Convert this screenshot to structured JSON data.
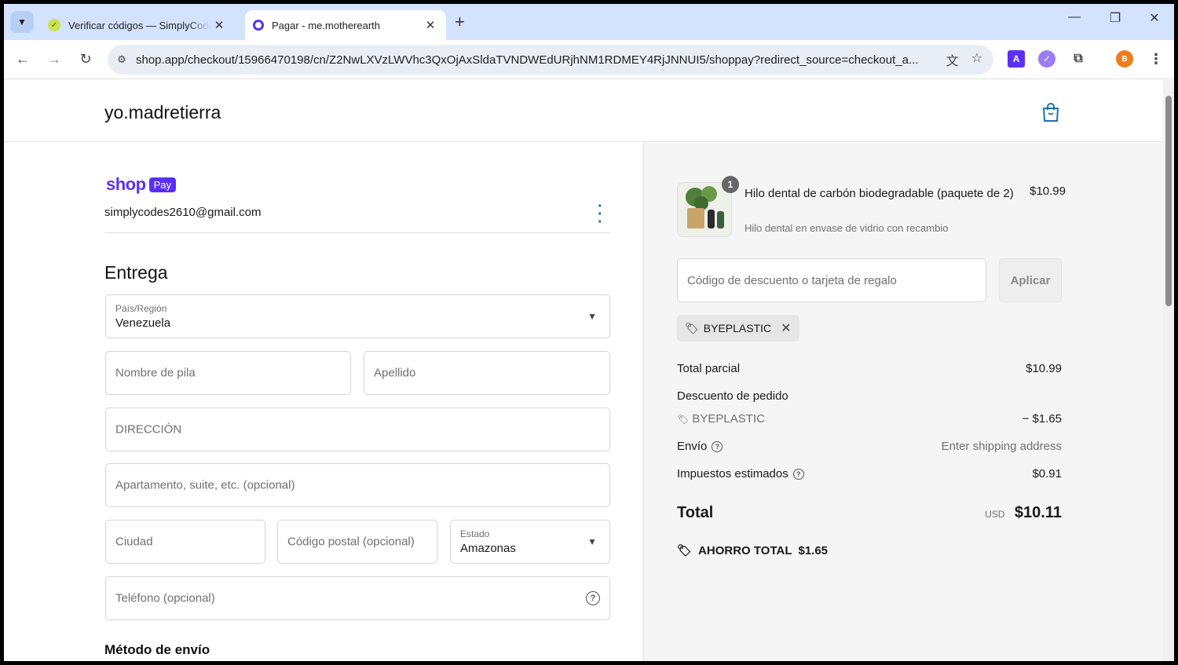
{
  "browser": {
    "tabs": [
      {
        "title": "Verificar códigos — SimplyCodes",
        "active": false
      },
      {
        "title": "Pagar - me.motherearth",
        "active": true
      }
    ],
    "url": "shop.app/checkout/15966470198/cn/Z2NwLXVzLWVhc3QxOjAxSldaTVNDWEdURjhNM1RDMEY4RjJNNUI5/shoppay?redirect_source=checkout_a...",
    "profile_initial": "B",
    "ext_letter": "A"
  },
  "header": {
    "shop_name": "yo.madretierra"
  },
  "account": {
    "shop_label": "shop",
    "pay_label": "Pay",
    "email": "simplycodes2610@gmail.com"
  },
  "delivery": {
    "heading": "Entrega",
    "country_label": "País/Región",
    "country_value": "Venezuela",
    "first_name_ph": "Nombre de pila",
    "last_name_ph": "Apellido",
    "address_ph": "DIRECCIÓN",
    "apartment_ph": "Apartamento, suite, etc. (opcional)",
    "city_ph": "Ciudad",
    "postal_ph": "Código postal (opcional)",
    "state_label": "Estado",
    "state_value": "Amazonas",
    "phone_ph": "Teléfono (opcional)"
  },
  "shipping_method_heading": "Método de envío",
  "summary": {
    "product": {
      "name": "Hilo dental de carbón biodegradable (paquete de 2)",
      "variant": "Hilo dental en envase de vidrio con recambio",
      "price": "$10.99",
      "quantity": "1"
    },
    "discount_ph": "Código de descuento o tarjeta de regalo",
    "apply_label": "Aplicar",
    "applied_code": "BYEPLASTIC",
    "subtotal_label": "Total parcial",
    "subtotal_value": "$10.99",
    "order_discount_label": "Descuento de pedido",
    "order_discount_code": "BYEPLASTIC",
    "order_discount_value": "− $1.65",
    "shipping_label": "Envío",
    "shipping_value": "Enter shipping address",
    "taxes_label": "Impuestos estimados",
    "taxes_value": "$0.91",
    "total_label": "Total",
    "currency": "USD",
    "total_value": "$10.11",
    "savings_label": "AHORRO TOTAL",
    "savings_value": "$1.65"
  },
  "colors": {
    "shop_purple": "#5a31f4",
    "link_blue": "#1773b0",
    "tab_strip": "#d3e3fd"
  }
}
